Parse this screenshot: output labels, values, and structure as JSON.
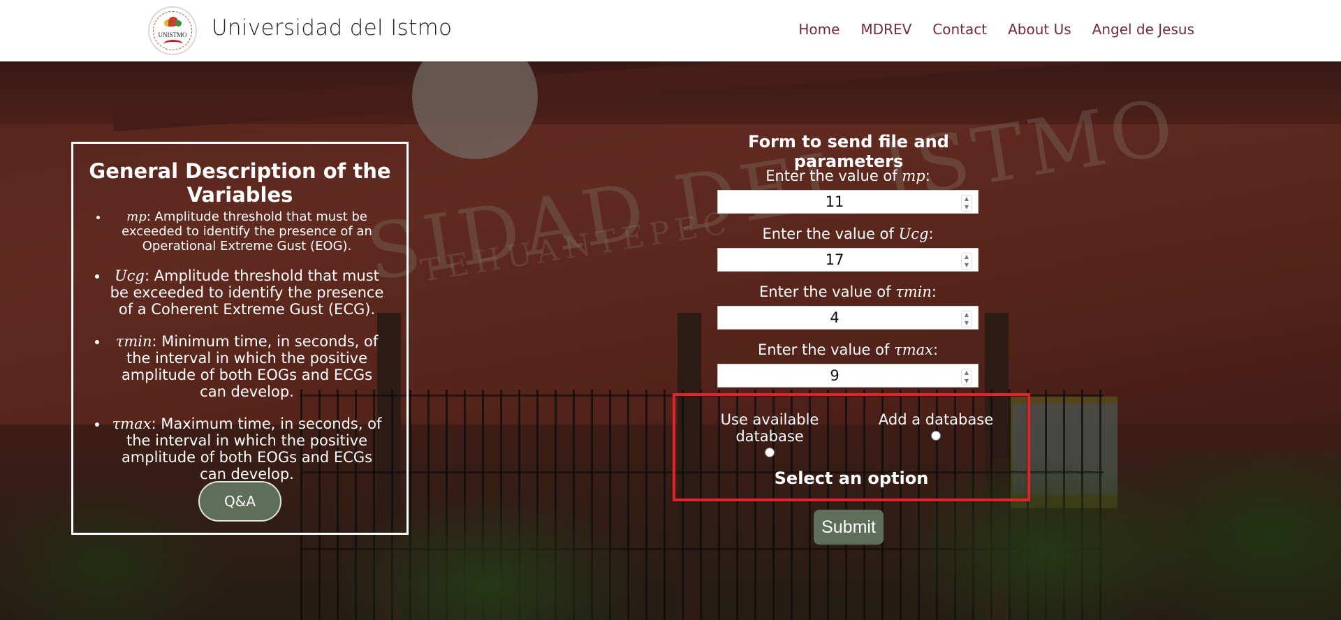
{
  "header": {
    "logo_text": "UNISTMO",
    "brand": "Universidad del Istmo",
    "nav": [
      "Home",
      "MDREV",
      "Contact",
      "About Us",
      "Angel de Jesus"
    ]
  },
  "description": {
    "title": "General Description of the Variables",
    "items": [
      {
        "symbol": "mp",
        "text": ": Amplitude threshold that must be exceeded to identify the presence of an Operational Extreme Gust (EOG)."
      },
      {
        "symbol": "Ucg",
        "text": ": Amplitude threshold that must be exceeded to identify the presence of a Coherent Extreme Gust (ECG)."
      },
      {
        "symbol": "τmin",
        "text": ": Minimum time, in seconds, of the interval in which the positive amplitude of both EOGs and ECGs can develop."
      },
      {
        "symbol": "τmax",
        "text": ": Maximum time, in seconds, of the interval in which the positive amplitude of both EOGs and ECGs can develop."
      }
    ],
    "qa_button": "Q&A"
  },
  "form": {
    "title": "Form to send file and parameters",
    "label_prefix": "Enter the value of ",
    "label_suffix": ":",
    "fields": [
      {
        "symbol": "mp",
        "value": "11"
      },
      {
        "symbol": "Ucg",
        "value": "17"
      },
      {
        "symbol": "τmin",
        "value": "4"
      },
      {
        "symbol": "τmax",
        "value": "9"
      }
    ],
    "options": [
      "Use available database",
      "Add a database"
    ],
    "select_message": "Select an option",
    "submit_label": "Submit"
  },
  "colors": {
    "nav_link": "#6e2a3a",
    "button_green": "#5e6e5a",
    "highlight_border": "#e0242c"
  }
}
